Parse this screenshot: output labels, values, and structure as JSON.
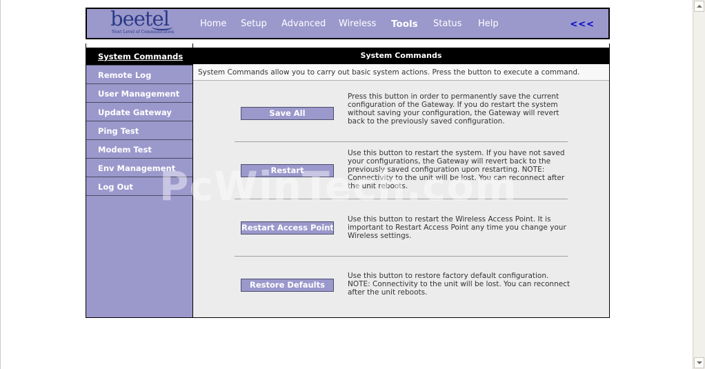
{
  "logo": {
    "text": "beetel",
    "tagline": "Next Level of Communication"
  },
  "nav": {
    "items": [
      {
        "label": "Home"
      },
      {
        "label": "Setup"
      },
      {
        "label": "Advanced"
      },
      {
        "label": "Wireless"
      },
      {
        "label": "Tools",
        "active": true
      },
      {
        "label": "Status"
      },
      {
        "label": "Help"
      }
    ],
    "back_label": "<<<"
  },
  "sidebar": {
    "items": [
      {
        "label": "System Commands",
        "active": true
      },
      {
        "label": "Remote Log"
      },
      {
        "label": "User Management"
      },
      {
        "label": "Update Gateway"
      },
      {
        "label": "Ping Test"
      },
      {
        "label": "Modem Test"
      },
      {
        "label": "Env Management"
      },
      {
        "label": "Log Out"
      }
    ]
  },
  "content": {
    "title": "System Commands",
    "intro": "System Commands allow you to carry out basic system actions. Press the button to execute a command.",
    "commands": [
      {
        "button": "Save All",
        "description": "Press this button in order to permanently save the current configuration of the Gateway. If you do restart the system without saving your configuration, the Gateway will revert back to the previously saved configuration."
      },
      {
        "button": "Restart",
        "description": "Use this button to restart the system. If you have not saved your configurations, the Gateway will revert back to the previously saved configuration upon restarting. NOTE: Connectivity to the unit will be lost. You can reconnect after the unit reboots."
      },
      {
        "button": "Restart Access Point",
        "description": "Use this button to restart the Wireless Access Point. It is important to Restart Access Point any time you change your Wireless settings."
      },
      {
        "button": "Restore Defaults",
        "description": "Use this button to restore factory default configuration. NOTE: Connectivity to the unit will be lost. You can reconnect after the unit reboots."
      }
    ]
  },
  "watermark": "PcWinTech.com",
  "colors": {
    "accent": "#9b98cc",
    "header_bar": "#000000",
    "back_link": "#0000cc"
  }
}
